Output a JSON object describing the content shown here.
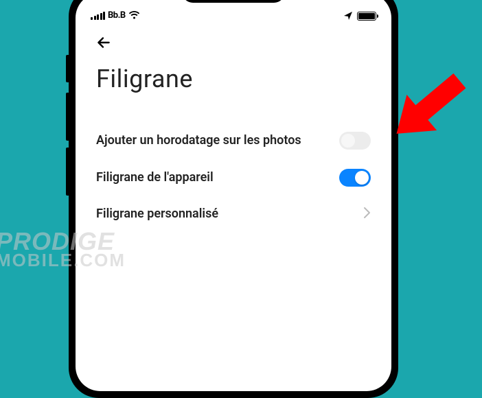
{
  "statusbar": {
    "carrier": "Bb.B"
  },
  "page": {
    "title": "Filigrane"
  },
  "settings": {
    "timestamp": {
      "label": "Ajouter un horodatage sur les photos",
      "enabled": false
    },
    "device_watermark": {
      "label": "Filigrane de l'appareil",
      "enabled": true
    },
    "custom_watermark": {
      "label": "Filigrane personnalisé"
    }
  },
  "overlay": {
    "watermark_line1": "PRODIGE",
    "watermark_line2": "MOBILE.COM"
  }
}
